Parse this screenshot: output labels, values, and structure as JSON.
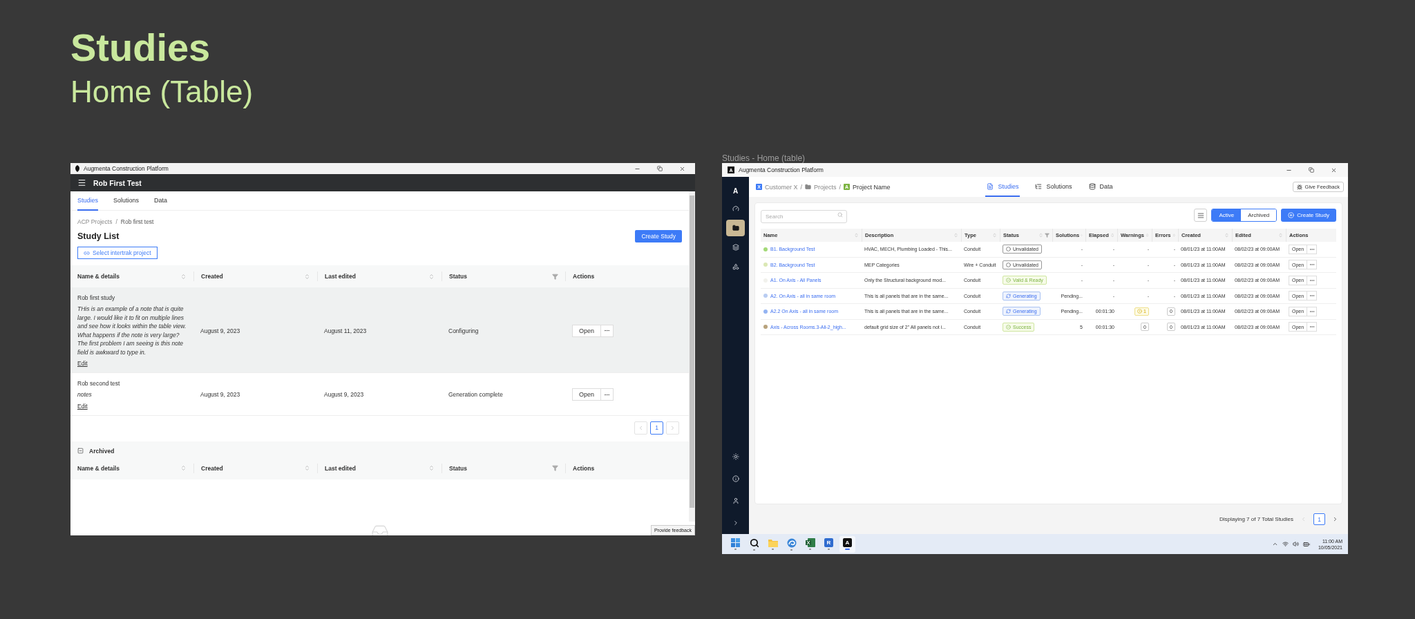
{
  "canvas": {
    "title": "Studies",
    "subtitle": "Home (Table)",
    "frame_label": "Studies - Home (table)"
  },
  "left_window": {
    "title": "Augmenta Construction Platform",
    "app_title": "Rob First Test",
    "tabs": [
      {
        "label": "Studies",
        "selected": true
      },
      {
        "label": "Solutions",
        "selected": false
      },
      {
        "label": "Data",
        "selected": false
      }
    ],
    "breadcrumb": [
      {
        "kind": "link",
        "label": "ACP Projects"
      },
      {
        "kind": "separator",
        "label": "/"
      },
      {
        "kind": "current",
        "label": "Rob first test"
      }
    ],
    "heading": "Study List",
    "create_button": "Create Study",
    "link_button": "Select intertrak project",
    "table": {
      "columns": [
        {
          "label": "Name & details",
          "kind": "sort"
        },
        {
          "label": "Created",
          "kind": "sort"
        },
        {
          "label": "Last edited",
          "kind": "sort"
        },
        {
          "label": "Status",
          "kind": "filter"
        },
        {
          "label": "Actions",
          "kind": "plain"
        }
      ],
      "rows": [
        {
          "name": "Rob first study",
          "note": "THis is an example of a note that is quite large. I would like it to fit on multiple lines and see how it looks within the table view. What happens if the note is very large? The first problem I am seeing is this note field is awkward to type in.",
          "edit": "Edit",
          "created": "August 9, 2023",
          "edited": "August 11, 2023",
          "status": "Configuring",
          "open": "Open",
          "selected": true
        },
        {
          "name": "Rob second test",
          "note": "notes",
          "edit": "Edit",
          "created": "August 9, 2023",
          "edited": "August 9, 2023",
          "status": "Generation complete",
          "open": "Open",
          "selected": false
        }
      ]
    },
    "pagination": [
      {
        "label": "1",
        "selected": true
      }
    ],
    "archived": {
      "label": "Archived",
      "expanded": true,
      "columns": [
        {
          "label": "Name & details",
          "kind": "sort"
        },
        {
          "label": "Created",
          "kind": "sort"
        },
        {
          "label": "Last edited",
          "kind": "sort"
        },
        {
          "label": "Status",
          "kind": "filter"
        },
        {
          "label": "Actions",
          "kind": "plain"
        }
      ]
    },
    "feedback": "Provide feedback"
  },
  "right_window": {
    "title": "Augmenta Construction Platform",
    "logo": "A",
    "sidebar": {
      "logo": "A",
      "items": [
        {
          "kind": "gauge",
          "selected": false
        },
        {
          "kind": "folder",
          "selected": true
        },
        {
          "kind": "squares",
          "selected": false
        },
        {
          "kind": "shapes",
          "selected": false
        }
      ],
      "bottom_items": [
        {
          "kind": "sun",
          "selected": false
        },
        {
          "kind": "info",
          "selected": false
        },
        {
          "kind": "user",
          "selected": false
        },
        {
          "kind": "expand",
          "selected": false
        }
      ]
    },
    "breadcrumb": [
      {
        "kind": "customer",
        "badge": "X",
        "label": "Customer X"
      },
      {
        "kind": "separator",
        "label": "/"
      },
      {
        "kind": "folder",
        "label": "Projects"
      },
      {
        "kind": "separator",
        "label": "/"
      },
      {
        "kind": "project",
        "badge": "A",
        "label": "Project Name"
      }
    ],
    "tabs": [
      {
        "kind": "studies",
        "label": "Studies",
        "selected": true
      },
      {
        "kind": "solutions",
        "label": "Solutions",
        "selected": false
      },
      {
        "kind": "data",
        "label": "Data",
        "selected": false
      }
    ],
    "feedback_button": "Give Feedback",
    "search": {
      "placeholder": "Search"
    },
    "view_filter": [
      {
        "label": "Active",
        "selected": true
      },
      {
        "label": "Archived",
        "selected": false
      }
    ],
    "create_button": "Create Study",
    "table": {
      "columns": [
        {
          "label": "Name",
          "kind": "sort"
        },
        {
          "label": "Description",
          "kind": "sort"
        },
        {
          "label": "Type",
          "kind": "sort"
        },
        {
          "label": "Status",
          "kind": "sort_filter"
        },
        {
          "label": "Solutions",
          "kind": "sort"
        },
        {
          "label": "Elapsed",
          "kind": "sort"
        },
        {
          "label": "Warnings",
          "kind": "sort"
        },
        {
          "label": "Errors",
          "kind": "sort"
        },
        {
          "label": "Created",
          "kind": "sort"
        },
        {
          "label": "Edited",
          "kind": "sort"
        },
        {
          "label": "Actions",
          "kind": "plain"
        }
      ],
      "rows": [
        {
          "name": "B1. Background Test",
          "color": "#a3d977",
          "description": "HVAC, MECH, Plumbing Loaded - This...",
          "type": "Conduit",
          "status": {
            "kind": "unvalidated",
            "label": "Unvalidated"
          },
          "solutions": "-",
          "elapsed": "-",
          "warnings": {
            "kind": "none",
            "text": "-"
          },
          "errors": {
            "kind": "none",
            "text": "-"
          },
          "created": "08/01/23 at 11:00AM",
          "edited": "08/02/23 at 09:00AM",
          "open": "Open"
        },
        {
          "name": "B2. Background Test",
          "color": "#dbe8b5",
          "description": "MEP Categories",
          "type": "Wire + Conduit",
          "status": {
            "kind": "unvalidated",
            "label": "Unvalidated"
          },
          "solutions": "-",
          "elapsed": "-",
          "warnings": {
            "kind": "none",
            "text": "-"
          },
          "errors": {
            "kind": "none",
            "text": "-"
          },
          "created": "08/01/23 at 11:00AM",
          "edited": "08/02/23 at 09:00AM",
          "open": "Open"
        },
        {
          "name": "A1. On Axis - All Panels",
          "color": "#f1f1ec",
          "description": "Only the Structural background mod...",
          "type": "Conduit",
          "status": {
            "kind": "valid",
            "label": "Valid & Ready"
          },
          "solutions": "-",
          "elapsed": "-",
          "warnings": {
            "kind": "none",
            "text": "-"
          },
          "errors": {
            "kind": "none",
            "text": "-"
          },
          "created": "08/01/23 at 11:00AM",
          "edited": "08/02/23 at 09:00AM",
          "open": "Open"
        },
        {
          "name": "A2. On Axis - all in same room",
          "color": "#b9cdf2",
          "description": "This is all panels that are in the same...",
          "type": "Conduit",
          "status": {
            "kind": "generating",
            "label": "Generating"
          },
          "solutions": "Pending...",
          "elapsed": "-",
          "warnings": {
            "kind": "none",
            "text": "-"
          },
          "errors": {
            "kind": "none",
            "text": "-"
          },
          "created": "08/01/23 at 11:00AM",
          "edited": "08/02/23 at 09:00AM",
          "open": "Open"
        },
        {
          "name": "A2.2 On Axis - all in same room",
          "color": "#94b4f2",
          "description": "This is all panels that are in the same...",
          "type": "Conduit",
          "status": {
            "kind": "generating",
            "label": "Generating"
          },
          "solutions": "Pending...",
          "elapsed": "00:01:30",
          "warnings": {
            "kind": "alert",
            "text": "1"
          },
          "errors": {
            "kind": "count",
            "text": "0"
          },
          "created": "08/01/23 at 11:00AM",
          "edited": "08/02/23 at 09:00AM",
          "open": "Open"
        },
        {
          "name": "Axis - Across Rooms.3-Ali-2_high...",
          "color": "#b8a27c",
          "description": "default grid size of 2\" All panels not i...",
          "type": "Conduit",
          "status": {
            "kind": "success",
            "label": "Success"
          },
          "solutions": "5",
          "elapsed": "00:01:30",
          "warnings": {
            "kind": "count",
            "text": "0"
          },
          "errors": {
            "kind": "count",
            "text": "0"
          },
          "created": "08/01/23 at 11:00AM",
          "edited": "08/02/23 at 09:00AM",
          "open": "Open"
        }
      ]
    },
    "footer": {
      "summary": "Displaying 7 of 7 Total Studies",
      "pages": [
        {
          "label": "1",
          "selected": true
        }
      ]
    },
    "taskbar": {
      "apps": [
        {
          "kind": "start",
          "selected": false
        },
        {
          "kind": "search",
          "selected": false
        },
        {
          "kind": "explorer",
          "selected": false
        },
        {
          "kind": "browser",
          "selected": false
        },
        {
          "kind": "excel",
          "selected": false
        },
        {
          "kind": "revit",
          "label": "R",
          "selected": false
        },
        {
          "kind": "augmenta",
          "label": "A",
          "selected": true
        }
      ],
      "time": "11:00 AM",
      "date": "10/05/2021"
    }
  }
}
